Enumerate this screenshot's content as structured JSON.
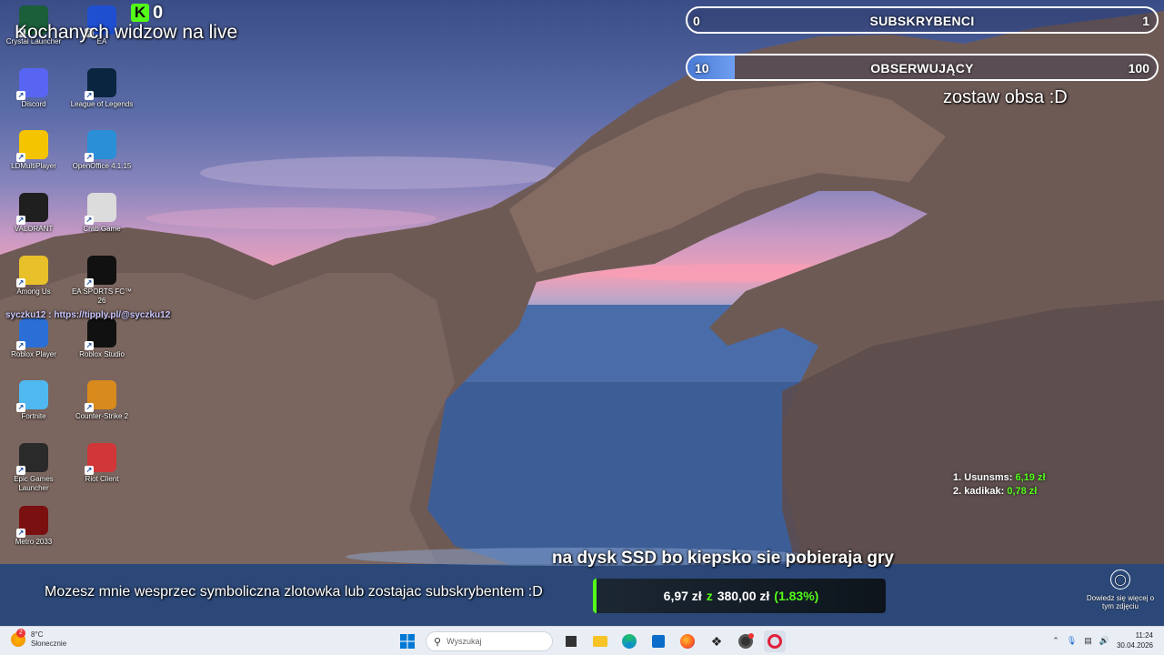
{
  "desktop": {
    "icons": [
      {
        "label": "Crystal Launcher",
        "icon": "crystal-launcher-icon",
        "color": "#1b5e3a"
      },
      {
        "label": "EA",
        "icon": "ea-app-icon",
        "color": "#1f4fd1"
      },
      {
        "label": "Discord",
        "icon": "discord-icon",
        "color": "#5865f2"
      },
      {
        "label": "League of Legends",
        "icon": "league-of-legends-icon",
        "color": "#0a2540"
      },
      {
        "label": "LDMultiPlayer",
        "icon": "ldmultiplayer-icon",
        "color": "#f5c400"
      },
      {
        "label": "OpenOffice 4.1.15",
        "icon": "openoffice-icon",
        "color": "#2a8fd6"
      },
      {
        "label": "VALORANT",
        "icon": "valorant-icon",
        "color": "#1f1f1f"
      },
      {
        "label": "Crab Game",
        "icon": "crab-game-icon",
        "color": "#dcdcdc"
      },
      {
        "label": "Among Us",
        "icon": "among-us-icon",
        "color": "#e8c02a"
      },
      {
        "label": "EA SPORTS FC™ 26",
        "icon": "ea-fc-26-icon",
        "color": "#111111"
      },
      {
        "label": "Roblox Player",
        "icon": "roblox-player-icon",
        "color": "#2b6fd6"
      },
      {
        "label": "Roblox Studio",
        "icon": "roblox-studio-icon",
        "color": "#111111"
      },
      {
        "label": "Fortnite",
        "icon": "fortnite-icon",
        "color": "#4fb8f0"
      },
      {
        "label": "Counter-Strike 2",
        "icon": "counter-strike-2-icon",
        "color": "#d88a1c"
      },
      {
        "label": "Epic Games Launcher",
        "icon": "epic-games-icon",
        "color": "#2a2a2a"
      },
      {
        "label": "Riot Client",
        "icon": "riot-client-icon",
        "color": "#d13639"
      },
      {
        "label": "Metro 2033",
        "icon": "metro-2033-icon",
        "color": "#7a1010"
      }
    ]
  },
  "stream": {
    "welcome_text": "Kochanych widzow na live",
    "kick_count": "0",
    "subs_goal": {
      "title": "SUBSKRYBENCI",
      "current": "0",
      "target": "1",
      "progress": 0.0
    },
    "follow_goal": {
      "title": "OBSERWUJĄCY",
      "current": "10",
      "target": "100",
      "progress": 0.1
    },
    "follow_note": "zostaw obsa :D",
    "tipply_text": "syczku12 : https://tipply.pl/@syczku12",
    "ssd_text": "na dysk SSD bo kiepsko sie pobieraja gry",
    "support_text": "Mozesz mnie wesprzec symboliczna zlotowka lub zostajac subskrybentem  :D",
    "tip_goal": {
      "collected": "6,97 zł",
      "sep": "z",
      "target": "380,00 zł",
      "percent": "(1.83%)"
    },
    "top_donors": [
      {
        "rank": "1.",
        "name": "Usunsms:",
        "amount": "6,19 zł"
      },
      {
        "rank": "2.",
        "name": "kadikak:",
        "amount": "0,78 zł"
      }
    ],
    "learn_more": "Dowiedz się więcej o tym zdjęciu"
  },
  "taskbar": {
    "weather_temp": "8°C",
    "weather_desc": "Słonecznie",
    "weather_badge": "2",
    "search_placeholder": "Wyszukaj",
    "time": "11:24",
    "date": "30.04.2026",
    "accent": "#0067c0"
  }
}
